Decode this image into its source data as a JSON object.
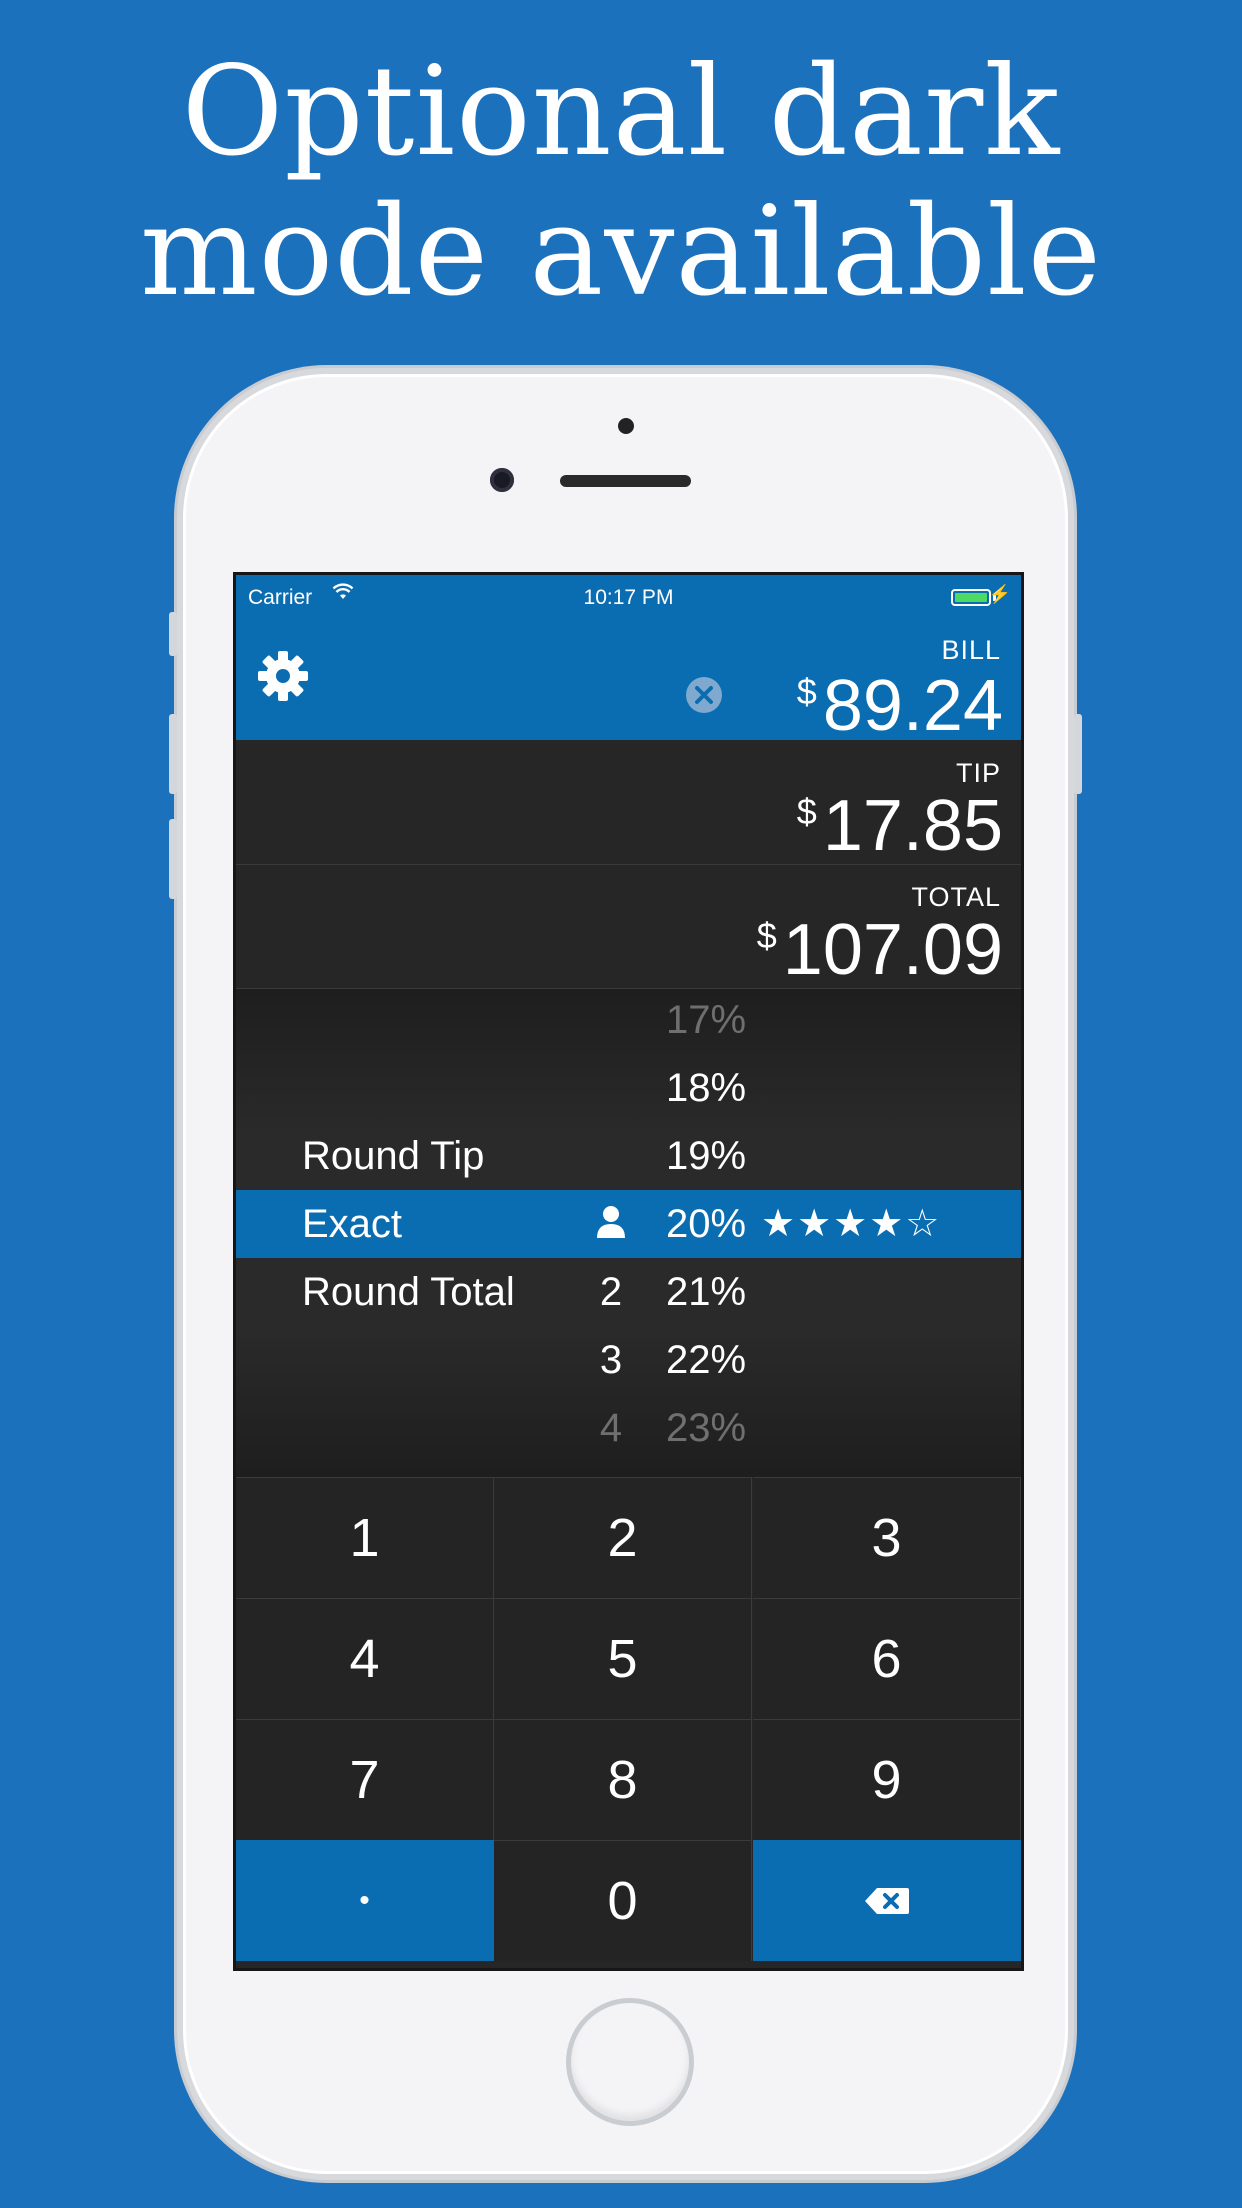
{
  "headline": {
    "line1": "Optional dark",
    "line2": "mode available"
  },
  "status_bar": {
    "carrier": "Carrier",
    "time": "10:17 PM",
    "battery_color": "#4cd964",
    "bolt": "⚡"
  },
  "header": {
    "settings_icon": "gear-icon",
    "clear_icon": "close-circle-icon",
    "bill_label": "BILL",
    "currency": "$",
    "bill_amount": "89.24"
  },
  "tip": {
    "label": "TIP",
    "currency": "$",
    "amount": "17.85"
  },
  "total": {
    "label": "TOTAL",
    "currency": "$",
    "amount": "107.09"
  },
  "picker": {
    "rows": [
      {
        "round": "",
        "split": "",
        "percent": "17%",
        "stars": ""
      },
      {
        "round": "",
        "split": "",
        "percent": "18%",
        "stars": ""
      },
      {
        "round": "Round Tip",
        "split": "",
        "percent": "19%",
        "stars": ""
      },
      {
        "round": "Exact",
        "split": "👤",
        "percent": "20%",
        "stars": "★★★★☆"
      },
      {
        "round": "Round Total",
        "split": "2",
        "percent": "21%",
        "stars": ""
      },
      {
        "round": "",
        "split": "3",
        "percent": "22%",
        "stars": ""
      },
      {
        "round": "",
        "split": "4",
        "percent": "23%",
        "stars": ""
      }
    ],
    "selected_index": 3
  },
  "keypad": {
    "keys": [
      "1",
      "2",
      "3",
      "4",
      "5",
      "6",
      "7",
      "8",
      "9",
      "•",
      "0",
      "⌫"
    ]
  },
  "colors": {
    "background": "#1c71bd",
    "accent": "#0b6db1",
    "dark": "#262626"
  }
}
